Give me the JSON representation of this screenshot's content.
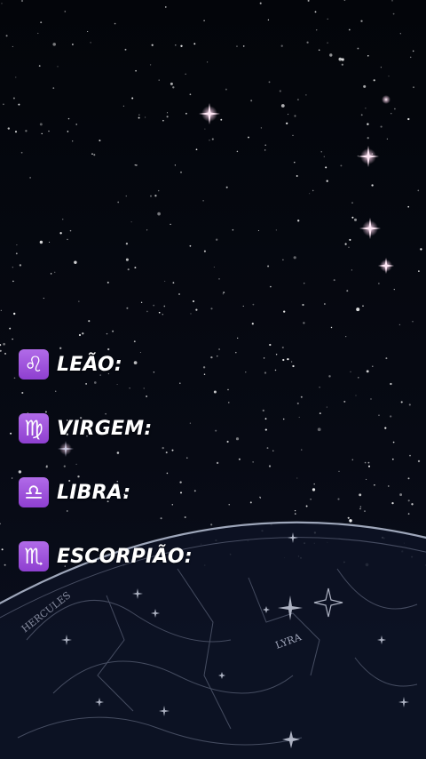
{
  "colors": {
    "background": "#05070d",
    "badge": "#9b4fdc",
    "text": "#ffffff"
  },
  "signs": [
    {
      "symbol": "♌",
      "label": "LEÃO:"
    },
    {
      "symbol": "♍",
      "label": "VIRGEM:"
    },
    {
      "symbol": "♎",
      "label": "LIBRA:"
    },
    {
      "symbol": "♏",
      "label": "ESCORPIÃO:"
    }
  ],
  "chart_map": {
    "lyra_label": "LYRA",
    "hercules_label": "HERCULES"
  }
}
